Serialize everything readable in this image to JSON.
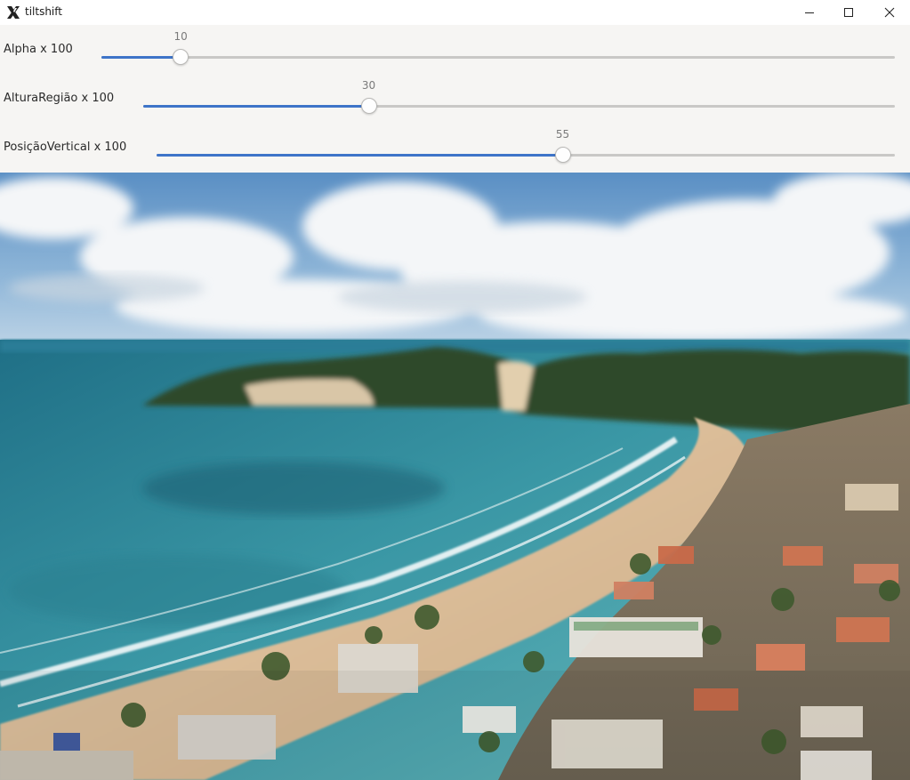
{
  "window": {
    "title": "tiltshift",
    "icons": {
      "app": "x-logo-icon",
      "minimize": "minimize-icon",
      "maximize": "maximize-icon",
      "close": "close-icon"
    }
  },
  "sliders": [
    {
      "label": "Alpha x 100",
      "value": "10",
      "fraction": 0.1
    },
    {
      "label": "AlturaRegião x 100",
      "value": "30",
      "fraction": 0.3
    },
    {
      "label": "PosiçãoVertical x 100",
      "value": "55",
      "fraction": 0.55
    }
  ],
  "colors": {
    "accent": "#3e74c8",
    "track": "#c9c8c6",
    "panel": "#f6f5f3"
  },
  "image": {
    "subject": "coastal-beach-photo"
  }
}
